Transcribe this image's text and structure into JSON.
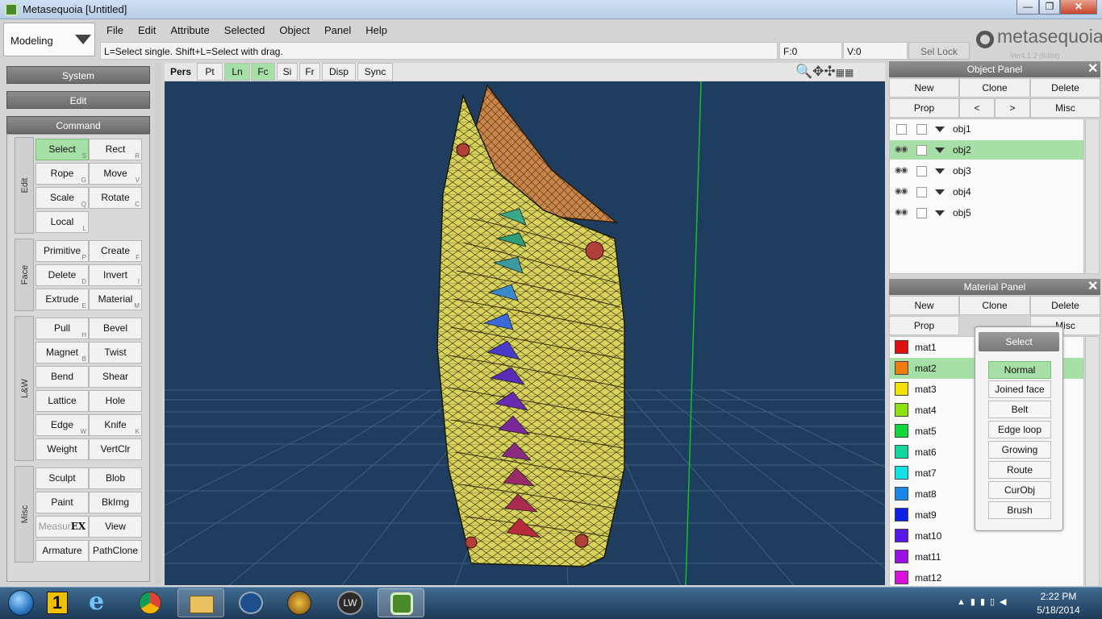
{
  "window": {
    "title": "Metasequoia [Untitled]",
    "min": "—",
    "max": "❐",
    "close": "✕"
  },
  "mode": {
    "value": "Modeling"
  },
  "menu": [
    "File",
    "Edit",
    "Attribute",
    "Selected",
    "Object",
    "Panel",
    "Help"
  ],
  "status": {
    "hint": "L=Select single.  Shift+L=Select with drag.",
    "f": "F:0",
    "v": "V:0",
    "sellock": "Sel Lock"
  },
  "logo": {
    "text": "metasequoia",
    "num": "4",
    "version": "Ver4.1.2 (64bit)"
  },
  "left": {
    "system": "System",
    "edit": "Edit",
    "command": "Command",
    "groups": {
      "edit": "Edit",
      "face": "Face",
      "lw": "L&W",
      "misc": "Misc"
    },
    "buttons": {
      "select": "Select",
      "rect": "Rect",
      "rope": "Rope",
      "move": "Move",
      "scale": "Scale",
      "rotate": "Rotate",
      "local": "Local",
      "primitive": "Primitive",
      "create": "Create",
      "delete": "Delete",
      "invert": "Invert",
      "extrude": "Extrude",
      "material": "Material",
      "pull": "Pull",
      "bevel": "Bevel",
      "magnet": "Magnet",
      "twist": "Twist",
      "bend": "Bend",
      "shear": "Shear",
      "lattice": "Lattice",
      "hole": "Hole",
      "edge": "Edge",
      "knife": "Knife",
      "weight": "Weight",
      "vertclr": "VertClr",
      "sculpt": "Sculpt",
      "blob": "Blob",
      "paint": "Paint",
      "bkimg": "BkImg",
      "measure": "Measur",
      "measure_ex": "EX",
      "view": "View",
      "armature": "Armature",
      "pathclone": "PathClone"
    },
    "shortcuts": {
      "select": "S",
      "rect": "R",
      "rope": "G",
      "move": "V",
      "scale": "Q",
      "rotate": "C",
      "local": "L",
      "primitive": "P",
      "create": "F",
      "delete": "D",
      "invert": "I",
      "extrude": "E",
      "material": "M",
      "pull": "H",
      "magnet": "B",
      "edge": "W",
      "knife": "K"
    }
  },
  "viewport_toolbar": [
    "Pers",
    "Pt",
    "Ln",
    "Fc",
    "Si",
    "Fr",
    "Disp",
    "Sync"
  ],
  "object_panel": {
    "title": "Object Panel",
    "buttons": [
      "New",
      "Clone",
      "Delete",
      "Prop",
      "<",
      ">",
      "Misc"
    ],
    "items": [
      {
        "name": "obj1",
        "visible": false
      },
      {
        "name": "obj2",
        "visible": true,
        "selected": true
      },
      {
        "name": "obj3",
        "visible": true
      },
      {
        "name": "obj4",
        "visible": true
      },
      {
        "name": "obj5",
        "visible": true
      }
    ]
  },
  "material_panel": {
    "title": "Material Panel",
    "buttons": [
      "New",
      "Clone",
      "Delete",
      "Prop",
      "Misc"
    ],
    "items": [
      {
        "name": "mat1",
        "color": "#e01010"
      },
      {
        "name": "mat2",
        "color": "#ee7a10",
        "selected": true
      },
      {
        "name": "mat3",
        "color": "#f2e200"
      },
      {
        "name": "mat4",
        "color": "#8de012"
      },
      {
        "name": "mat5",
        "color": "#10d83a"
      },
      {
        "name": "mat6",
        "color": "#10d89a"
      },
      {
        "name": "mat7",
        "color": "#10e2e8"
      },
      {
        "name": "mat8",
        "color": "#1a86e8"
      },
      {
        "name": "mat9",
        "color": "#1020e6"
      },
      {
        "name": "mat10",
        "color": "#5a18e8"
      },
      {
        "name": "mat11",
        "color": "#9a10e2"
      },
      {
        "name": "mat12",
        "color": "#d810d8"
      }
    ]
  },
  "select_popup": {
    "title": "Select",
    "options": [
      "Normal",
      "Joined face",
      "Belt",
      "Edge loop",
      "Growing",
      "Route",
      "CurObj",
      "Brush"
    ],
    "active": "Normal"
  },
  "taskbar": {
    "time": "2:22 PM",
    "date": "5/18/2014",
    "apps": [
      "1",
      "LW"
    ]
  }
}
